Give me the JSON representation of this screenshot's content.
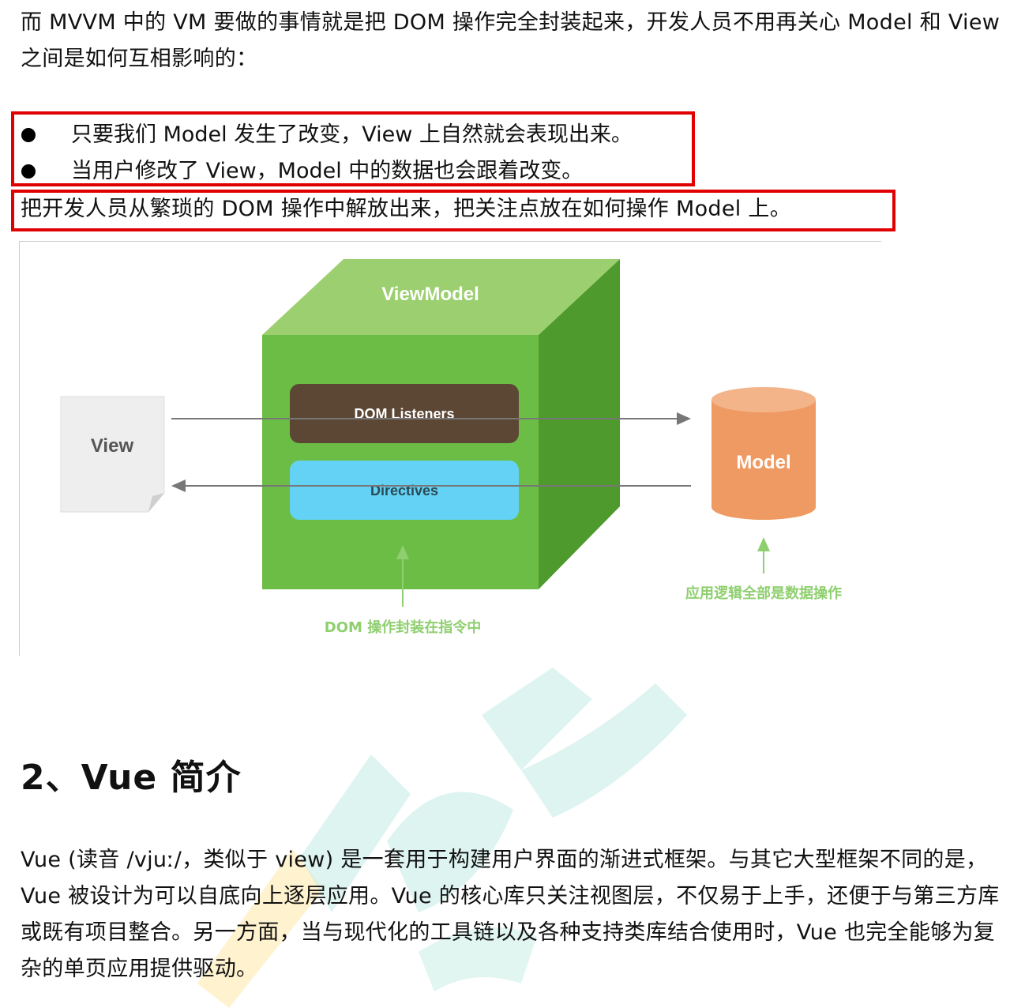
{
  "intro": {
    "text": "而 MVVM 中的 VM 要做的事情就是把 DOM 操作完全封装起来，开发人员不用再关心 Model 和 View 之间是如何互相影响的："
  },
  "bullets": [
    {
      "text": "只要我们 Model 发生了改变，View 上自然就会表现出来。"
    },
    {
      "text": "当用户修改了 View，Model 中的数据也会跟着改变。"
    }
  ],
  "summary": {
    "text": "把开发人员从繁琐的 DOM 操作中解放出来，把关注点放在如何操作 Model 上。"
  },
  "diagram": {
    "view_label": "View",
    "viewmodel_label": "ViewModel",
    "dom_listeners_label": "DOM Listeners",
    "directives_label": "Directives",
    "model_label": "Model",
    "dom_caption": "DOM 操作封装在指令中",
    "model_caption": "应用逻辑全部是数据操作",
    "colors": {
      "cube_front": "#6cbd45",
      "cube_top": "#9ccf6f",
      "cube_side": "#4f9a2d",
      "dom_listeners": "#5c4734",
      "directives": "#64d2f5",
      "model": "#ef9a63",
      "view": "#eeeeee",
      "caption": "#8fcf6f"
    }
  },
  "section": {
    "heading": "2、Vue 简介"
  },
  "vue_intro": {
    "text": "Vue (读音 /vjuː/，类似于 view) 是一套用于构建用户界面的渐进式框架。与其它大型框架不同的是，Vue 被设计为可以自底向上逐层应用。Vue 的核心库只关注视图层，不仅易于上手，还便于与第三方库或既有项目整合。另一方面，当与现代化的工具链以及各种支持类库结合使用时，Vue 也完全能够为复杂的单页应用提供驱动。"
  }
}
